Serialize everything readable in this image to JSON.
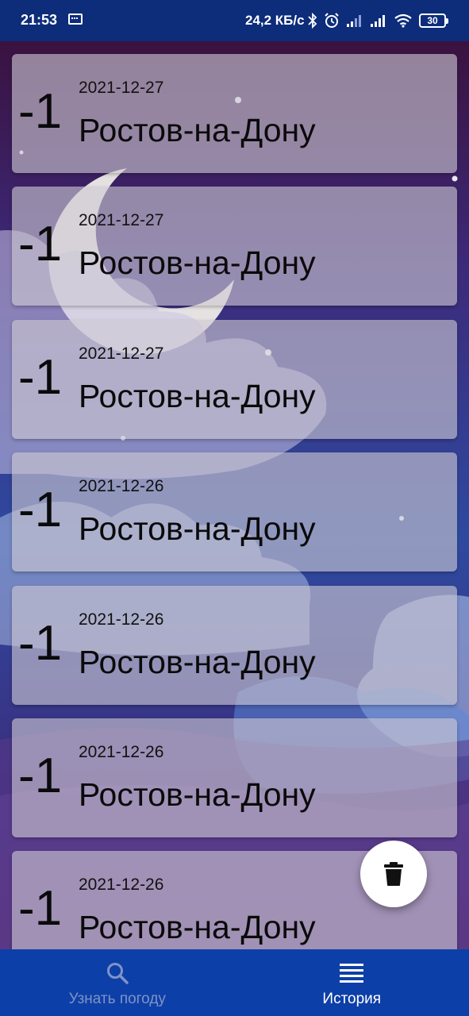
{
  "status_bar": {
    "time": "21:53",
    "speed": "24,2 КБ/с",
    "battery": "30",
    "icons": [
      "sim-card-icon",
      "bluetooth-icon",
      "alarm-icon",
      "signal-icon",
      "signal-icon",
      "wifi-icon",
      "battery-icon"
    ]
  },
  "history": [
    {
      "temp": "-1",
      "date": "2021-12-27",
      "city": "Ростов-на-Дону"
    },
    {
      "temp": "-1",
      "date": "2021-12-27",
      "city": "Ростов-на-Дону"
    },
    {
      "temp": "-1",
      "date": "2021-12-27",
      "city": "Ростов-на-Дону"
    },
    {
      "temp": "-1",
      "date": "2021-12-26",
      "city": "Ростов-на-Дону"
    },
    {
      "temp": "-1",
      "date": "2021-12-26",
      "city": "Ростов-на-Дону"
    },
    {
      "temp": "-1",
      "date": "2021-12-26",
      "city": "Ростов-на-Дону"
    },
    {
      "temp": "-1",
      "date": "2021-12-26",
      "city": "Ростов-на-Дону"
    }
  ],
  "fab": {
    "icon": "trash-icon"
  },
  "bottom_nav": {
    "items": [
      {
        "label": "Узнать погоду",
        "icon": "search-icon",
        "active": false
      },
      {
        "label": "История",
        "icon": "list-icon",
        "active": true
      }
    ]
  },
  "colors": {
    "status_bar": "#0d2c7a",
    "bottom_nav": "#0d3fa8",
    "card": "#cdc8d2"
  }
}
